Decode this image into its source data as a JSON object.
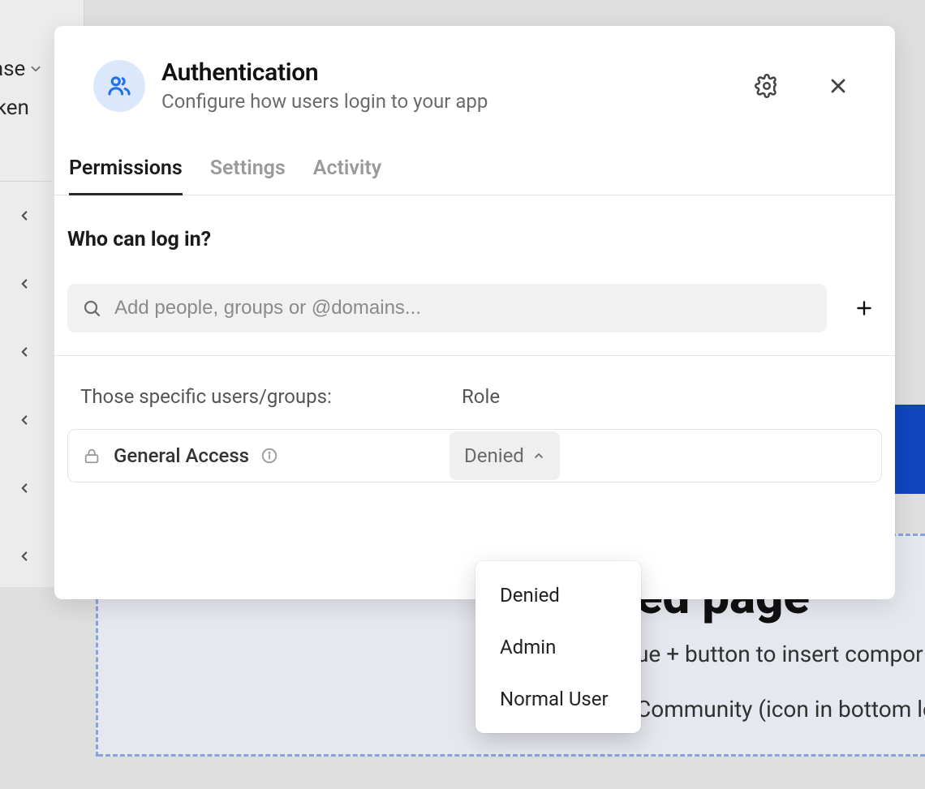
{
  "background": {
    "sidebar": {
      "label1": "ase",
      "label2": "oken"
    },
    "page_title": "ed page",
    "tip1": "ue + button to insert compor",
    "tip2": "Community (icon in bottom le"
  },
  "modal": {
    "icon": "people-icon",
    "title": "Authentication",
    "subtitle": "Configure how users login to your app",
    "tabs": [
      {
        "label": "Permissions",
        "active": true
      },
      {
        "label": "Settings",
        "active": false
      },
      {
        "label": "Activity",
        "active": false
      }
    ],
    "section_title": "Who can log in?",
    "search": {
      "placeholder": "Add people, groups or @domains..."
    },
    "columns": {
      "users": "Those specific users/groups:",
      "role": "Role"
    },
    "row": {
      "label": "General Access",
      "role_value": "Denied"
    },
    "role_options": [
      "Denied",
      "Admin",
      "Normal User"
    ]
  }
}
